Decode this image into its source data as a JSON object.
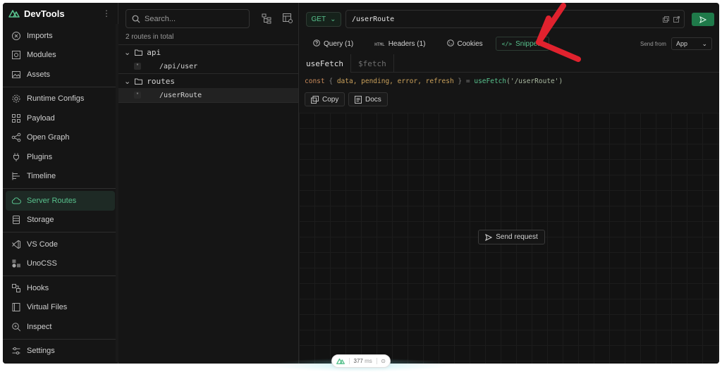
{
  "app": {
    "name": "DevTools",
    "menu_icon": "kebab-menu-icon"
  },
  "sidebar": {
    "groups": [
      [
        {
          "label": "Imports",
          "icon": "plug-circle-icon"
        },
        {
          "label": "Modules",
          "icon": "module-icon"
        },
        {
          "label": "Assets",
          "icon": "image-icon"
        }
      ],
      [
        {
          "label": "Runtime Configs",
          "icon": "gear-icon"
        },
        {
          "label": "Payload",
          "icon": "payload-icon"
        },
        {
          "label": "Open Graph",
          "icon": "share-icon"
        },
        {
          "label": "Plugins",
          "icon": "plug-icon"
        },
        {
          "label": "Timeline",
          "icon": "timeline-icon"
        }
      ],
      [
        {
          "label": "Server Routes",
          "icon": "cloud-icon",
          "active": true
        },
        {
          "label": "Storage",
          "icon": "database-icon"
        }
      ],
      [
        {
          "label": "VS Code",
          "icon": "vscode-icon"
        },
        {
          "label": "UnoCSS",
          "icon": "unocss-icon"
        }
      ],
      [
        {
          "label": "Hooks",
          "icon": "hook-icon"
        },
        {
          "label": "Virtual Files",
          "icon": "file-icon"
        },
        {
          "label": "Inspect",
          "icon": "inspect-icon"
        }
      ],
      [
        {
          "label": "Settings",
          "icon": "sliders-icon"
        }
      ]
    ]
  },
  "routes": {
    "search_placeholder": "Search...",
    "count_text": "2 routes in total",
    "folders": [
      {
        "name": "api",
        "routes": [
          {
            "method": "*",
            "path": "/api/user"
          }
        ]
      },
      {
        "name": "routes",
        "routes": [
          {
            "method": "*",
            "path": "/userRoute",
            "selected": true
          }
        ]
      }
    ]
  },
  "request": {
    "method": "GET",
    "url": "/userRoute",
    "send_icon": "send-icon"
  },
  "tabs": [
    {
      "label": "Query (1)",
      "icon": "question-circle-icon"
    },
    {
      "label": "Headers (1)",
      "icon": "html-icon"
    },
    {
      "label": "Cookies",
      "icon": "cookie-icon"
    },
    {
      "label": "Snippets",
      "icon": "code-icon",
      "active": true
    }
  ],
  "send_from": {
    "label": "Send from",
    "value": "App"
  },
  "snippet_tabs": [
    {
      "label": "useFetch",
      "active": true
    },
    {
      "label": "$fetch"
    }
  ],
  "code": {
    "kw": "const",
    "open": "{",
    "vars": "data, pending, error, refresh",
    "close": "}",
    "eq": "=",
    "fn": "useFetch",
    "arg": "('/userRoute')"
  },
  "buttons": {
    "copy": "Copy",
    "docs": "Docs",
    "send_request": "Send request"
  },
  "timing": {
    "value": "377",
    "unit": "ms"
  },
  "colors": {
    "accent": "#58c18d",
    "annotation_arrow": "#e0222e",
    "background": "#151515"
  }
}
